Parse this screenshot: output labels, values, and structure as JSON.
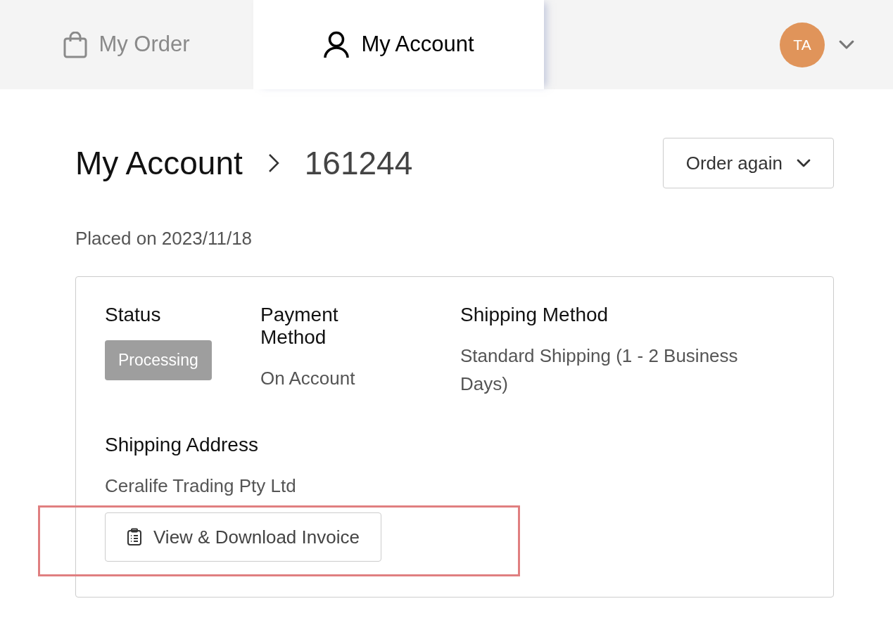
{
  "tabs": [
    {
      "label": "My Order",
      "selected": false
    },
    {
      "label": "My Account",
      "selected": true
    }
  ],
  "user": {
    "initials": "TA"
  },
  "breadcrumb": {
    "parent": "My Account",
    "current": "161244"
  },
  "order_again_button": "Order again",
  "placed_on": "Placed on 2023/11/18",
  "details": [
    {
      "kind": "badge",
      "label": "Status",
      "value": "Processing"
    },
    {
      "kind": "text",
      "label": "Payment Method",
      "value": "On Account"
    },
    {
      "kind": "text",
      "label": "Shipping Method",
      "value": "Standard Shipping (1 - 2 Business Days)"
    }
  ],
  "shipping_address": {
    "label": "Shipping Address",
    "value": "Ceralife Trading Pty Ltd"
  },
  "invoice_button": {
    "label": "View & Download Invoice",
    "highlighted": true
  }
}
